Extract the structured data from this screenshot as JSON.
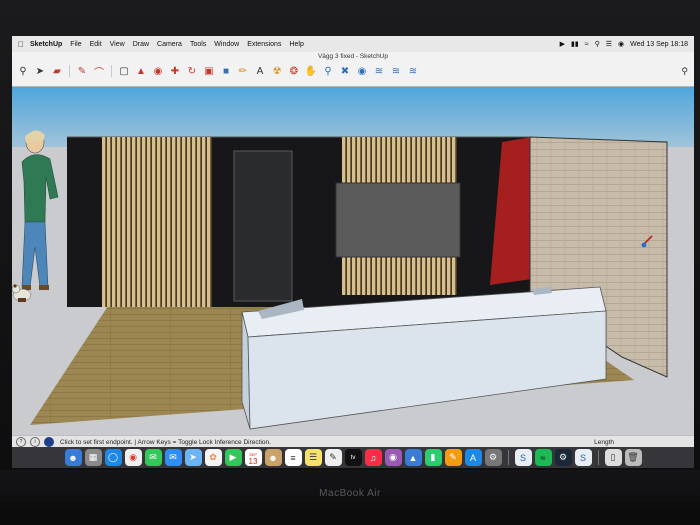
{
  "menubar": {
    "app_name": "SketchUp",
    "items": [
      "File",
      "Edit",
      "View",
      "Draw",
      "Camera",
      "Tools",
      "Window",
      "Extensions",
      "Help"
    ],
    "datetime": "Wed 13 Sep  18:18"
  },
  "window": {
    "title": "Vägg 3 fixed - SketchUp"
  },
  "statusbar": {
    "hint": "Click to set first endpoint. | Arrow Keys = Toggle Lock Inference Direction.",
    "measure_label": "Length"
  },
  "dock": {
    "calendar_day": "13",
    "calendar_month": "SEP",
    "appletv_label": "tv"
  },
  "laptop": {
    "brand": "MacBook Air"
  },
  "colors": {
    "sky_top": "#55a9dd",
    "floor": "#9a8550",
    "red_column": "#a52020",
    "sofa": "#dfe7ef"
  }
}
